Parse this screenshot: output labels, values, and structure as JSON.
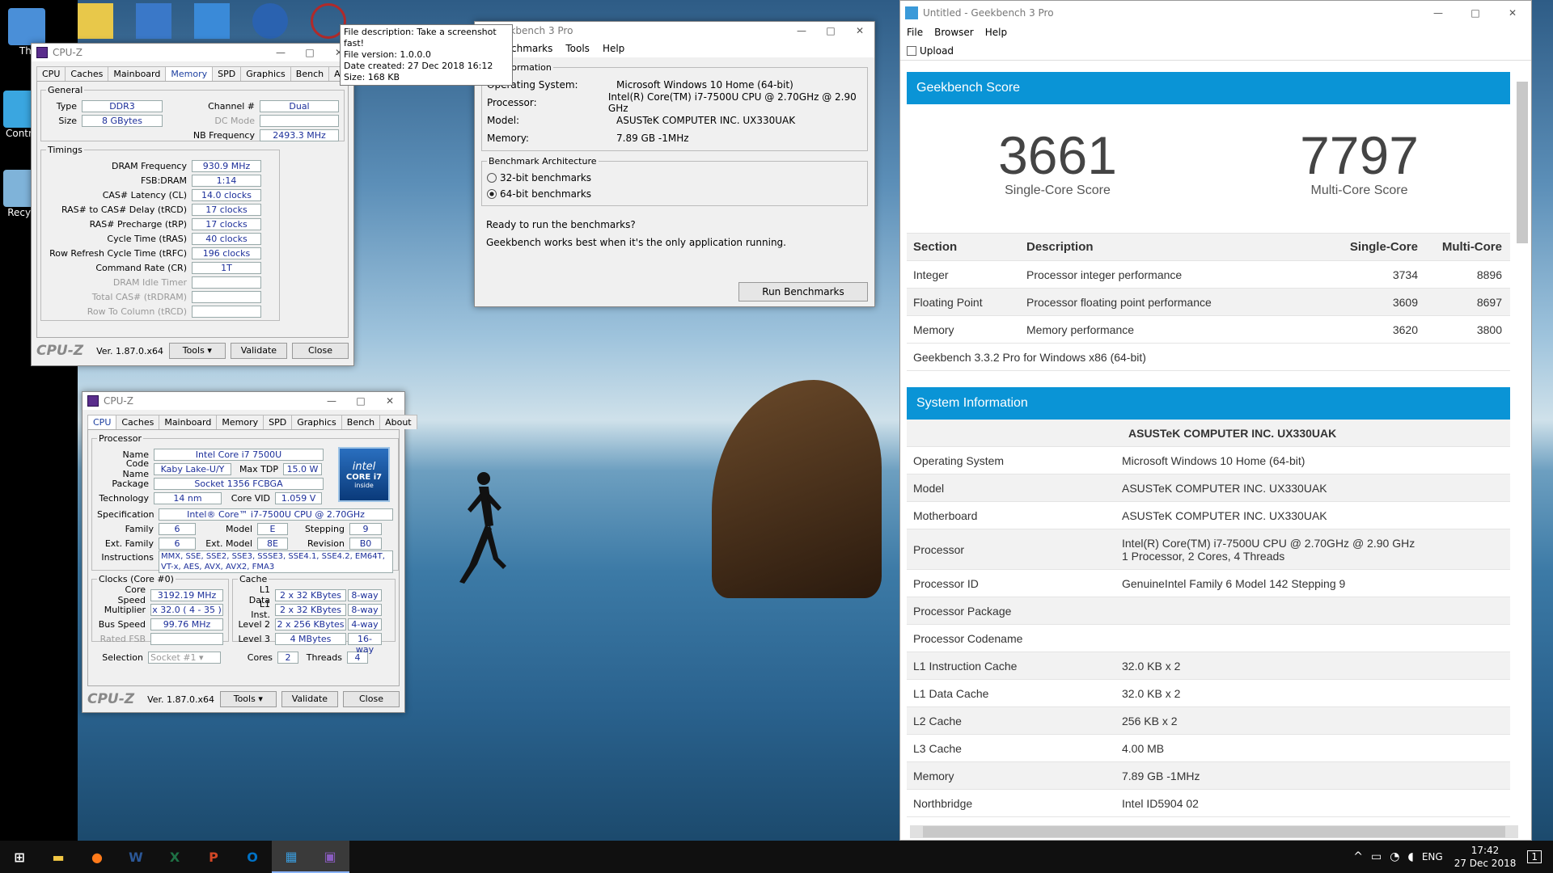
{
  "desktop": {
    "icons": [
      {
        "label": "Thi",
        "color": "#4a8fd8"
      },
      {
        "label": "Contro",
        "color": "#3aa6e0"
      },
      {
        "label": "Recyc",
        "color": "#7fb3d9"
      }
    ],
    "top_icon_colors": [
      "#e8c84a",
      "#3a78c8",
      "#3a8ad8",
      "#2a62b0",
      "#b02a2a"
    ]
  },
  "tooltip": {
    "line1": "File description: Take a screenshot fast!",
    "line2": "File version: 1.0.0.0",
    "line3": "Date created: 27 Dec 2018 16:12",
    "line4": "Size: 168 KB"
  },
  "cpuz_memory": {
    "title": "CPU-Z",
    "tabs": [
      "CPU",
      "Caches",
      "Mainboard",
      "Memory",
      "SPD",
      "Graphics",
      "Bench",
      "About"
    ],
    "general_legend": "General",
    "type_label": "Type",
    "type_value": "DDR3",
    "size_label": "Size",
    "size_value": "8 GBytes",
    "channel_label": "Channel #",
    "channel_value": "Dual",
    "dcmode_label": "DC Mode",
    "nbfreq_label": "NB Frequency",
    "nbfreq_value": "2493.3 MHz",
    "timings_legend": "Timings",
    "timings": [
      {
        "label": "DRAM Frequency",
        "value": "930.9 MHz",
        "dis": false
      },
      {
        "label": "FSB:DRAM",
        "value": "1:14",
        "dis": false
      },
      {
        "label": "CAS# Latency (CL)",
        "value": "14.0 clocks",
        "dis": false
      },
      {
        "label": "RAS# to CAS# Delay (tRCD)",
        "value": "17 clocks",
        "dis": false
      },
      {
        "label": "RAS# Precharge (tRP)",
        "value": "17 clocks",
        "dis": false
      },
      {
        "label": "Cycle Time (tRAS)",
        "value": "40 clocks",
        "dis": false
      },
      {
        "label": "Row Refresh Cycle Time (tRFC)",
        "value": "196 clocks",
        "dis": false
      },
      {
        "label": "Command Rate (CR)",
        "value": "1T",
        "dis": false
      },
      {
        "label": "DRAM Idle Timer",
        "value": "",
        "dis": true
      },
      {
        "label": "Total CAS# (tRDRAM)",
        "value": "",
        "dis": true
      },
      {
        "label": "Row To Column (tRCD)",
        "value": "",
        "dis": true
      }
    ],
    "logo": "CPU-Z",
    "version": "Ver. 1.87.0.x64",
    "tools": "Tools",
    "validate": "Validate",
    "close": "Close"
  },
  "cpuz_cpu": {
    "title": "CPU-Z",
    "tabs": [
      "CPU",
      "Caches",
      "Mainboard",
      "Memory",
      "SPD",
      "Graphics",
      "Bench",
      "About"
    ],
    "processor_legend": "Processor",
    "name_label": "Name",
    "name_value": "Intel Core i7 7500U",
    "codename_label": "Code Name",
    "codename_value": "Kaby Lake-U/Y",
    "maxtdp_label": "Max TDP",
    "maxtdp_value": "15.0 W",
    "package_label": "Package",
    "package_value": "Socket 1356 FCBGA",
    "tech_label": "Technology",
    "tech_value": "14 nm",
    "vid_label": "Core VID",
    "vid_value": "1.059 V",
    "spec_label": "Specification",
    "spec_value": "Intel® Core™ i7-7500U CPU @ 2.70GHz",
    "family_label": "Family",
    "family_value": "6",
    "model_label": "Model",
    "model_value": "E",
    "stepping_label": "Stepping",
    "stepping_value": "9",
    "extfamily_label": "Ext. Family",
    "extfamily_value": "6",
    "extmodel_label": "Ext. Model",
    "extmodel_value": "8E",
    "revision_label": "Revision",
    "revision_value": "B0",
    "instr_label": "Instructions",
    "instr_value": "MMX, SSE, SSE2, SSE3, SSSE3, SSE4.1, SSE4.2, EM64T, VT-x, AES, AVX, AVX2, FMA3",
    "intel_badge_top": "intel",
    "intel_badge_mid": "CORE i7",
    "intel_badge_bot": "inside",
    "clocks_legend": "Clocks (Core #0)",
    "corespeed_label": "Core Speed",
    "corespeed_value": "3192.19 MHz",
    "mult_label": "Multiplier",
    "mult_value": "x 32.0 ( 4 - 35 )",
    "bus_label": "Bus Speed",
    "bus_value": "99.76 MHz",
    "ratedfsb_label": "Rated FSB",
    "cache_legend": "Cache",
    "caches": [
      {
        "label": "L1 Data",
        "value": "2 x 32 KBytes",
        "way": "8-way"
      },
      {
        "label": "L1 Inst.",
        "value": "2 x 32 KBytes",
        "way": "8-way"
      },
      {
        "label": "Level 2",
        "value": "2 x 256 KBytes",
        "way": "4-way"
      },
      {
        "label": "Level 3",
        "value": "4 MBytes",
        "way": "16-way"
      }
    ],
    "selection_label": "Selection",
    "selection_value": "Socket #1",
    "cores_label": "Cores",
    "cores_value": "2",
    "threads_label": "Threads",
    "threads_value": "4",
    "logo": "CPU-Z",
    "version": "Ver. 1.87.0.x64",
    "tools": "Tools",
    "validate": "Validate",
    "close": "Close"
  },
  "gb_small": {
    "title": "ekbench 3 Pro",
    "menu": [
      "enchmarks",
      "Tools",
      "Help"
    ],
    "sysinfo_legend": "m Information",
    "sysinfo": [
      {
        "label": "Operating System:",
        "value": "Microsoft Windows 10 Home (64-bit)"
      },
      {
        "label": "Processor:",
        "value": "Intel(R) Core(TM) i7-7500U CPU @ 2.70GHz @ 2.90 GHz"
      },
      {
        "label": "Model:",
        "value": "ASUSTeK COMPUTER INC. UX330UAK"
      },
      {
        "label": "Memory:",
        "value": "7.89 GB -1MHz"
      }
    ],
    "arch_legend": "Benchmark Architecture",
    "radio32": "32-bit benchmarks",
    "radio64": "64-bit benchmarks",
    "ready": "Ready to run the benchmarks?",
    "works": "Geekbench works best when it's the only application running.",
    "run": "Run Benchmarks"
  },
  "gb_main": {
    "title": "Untitled - Geekbench 3 Pro",
    "menu": [
      "File",
      "Browser",
      "Help"
    ],
    "upload": "Upload",
    "score_header": "Geekbench Score",
    "single_score": "3661",
    "single_label": "Single-Core Score",
    "multi_score": "7797",
    "multi_label": "Multi-Core Score",
    "table_headers": [
      "Section",
      "Description",
      "Single-Core",
      "Multi-Core"
    ],
    "table_rows": [
      {
        "section": "Integer",
        "desc": "Processor integer performance",
        "single": "3734",
        "multi": "8896"
      },
      {
        "section": "Floating Point",
        "desc": "Processor floating point performance",
        "single": "3609",
        "multi": "8697"
      },
      {
        "section": "Memory",
        "desc": "Memory performance",
        "single": "3620",
        "multi": "3800"
      }
    ],
    "version_line": "Geekbench 3.3.2 Pro for Windows x86 (64-bit)",
    "sys_header": "System Information",
    "sys_title": "ASUSTeK COMPUTER INC. UX330UAK",
    "sys_rows": [
      {
        "label": "Operating System",
        "value": "Microsoft Windows 10 Home (64-bit)",
        "value2": ""
      },
      {
        "label": "Model",
        "value": "ASUSTeK COMPUTER INC. UX330UAK",
        "value2": ""
      },
      {
        "label": "Motherboard",
        "value": "ASUSTeK COMPUTER INC. UX330UAK",
        "value2": ""
      },
      {
        "label": "Processor",
        "value": "Intel(R) Core(TM) i7-7500U CPU @ 2.70GHz @ 2.90 GHz",
        "value2": "1 Processor, 2 Cores, 4 Threads"
      },
      {
        "label": "Processor ID",
        "value": "GenuineIntel Family 6 Model 142 Stepping 9",
        "value2": ""
      },
      {
        "label": "Processor Package",
        "value": "",
        "value2": ""
      },
      {
        "label": "Processor Codename",
        "value": "",
        "value2": ""
      },
      {
        "label": "L1 Instruction Cache",
        "value": "32.0 KB x 2",
        "value2": ""
      },
      {
        "label": "L1 Data Cache",
        "value": "32.0 KB x 2",
        "value2": ""
      },
      {
        "label": "L2 Cache",
        "value": "256 KB x 2",
        "value2": ""
      },
      {
        "label": "L3 Cache",
        "value": "4.00 MB",
        "value2": ""
      },
      {
        "label": "Memory",
        "value": "7.89 GB -1MHz",
        "value2": ""
      },
      {
        "label": "Northbridge",
        "value": "Intel ID5904 02",
        "value2": ""
      }
    ]
  },
  "taskbar": {
    "apps": [
      {
        "name": "start-button",
        "glyph": "⊞",
        "color": "#ffffff"
      },
      {
        "name": "file-explorer-icon",
        "glyph": "▬",
        "color": "#f2c744"
      },
      {
        "name": "firefox-icon",
        "glyph": "●",
        "color": "#ff7a1a"
      },
      {
        "name": "word-icon",
        "glyph": "W",
        "color": "#2b5797"
      },
      {
        "name": "excel-icon",
        "glyph": "X",
        "color": "#1e7145"
      },
      {
        "name": "powerpoint-icon",
        "glyph": "P",
        "color": "#d24726"
      },
      {
        "name": "outlook-icon",
        "glyph": "O",
        "color": "#0072c6"
      },
      {
        "name": "geekbench-icon",
        "glyph": "▦",
        "color": "#3a9ad9"
      },
      {
        "name": "cpuz-icon",
        "glyph": "▣",
        "color": "#8a5cc0"
      }
    ],
    "lang": "ENG",
    "time": "17:42",
    "date": "27 Dec 2018",
    "notify_count": "1"
  }
}
